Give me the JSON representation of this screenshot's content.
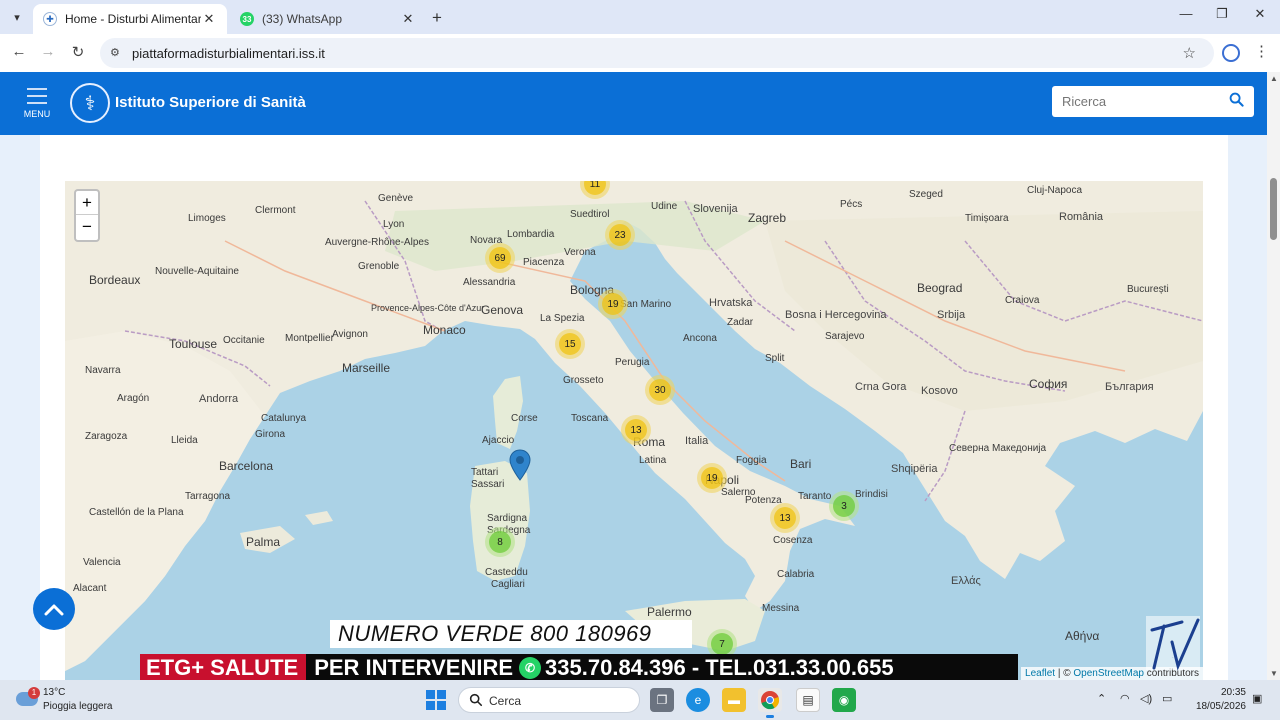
{
  "browser": {
    "tabs": [
      {
        "title": "Home - Disturbi Alimentari",
        "active": true,
        "favicon": "iss-favicon"
      },
      {
        "title": "(33) WhatsApp",
        "active": false,
        "favicon": "whatsapp-favicon",
        "badge": "33"
      }
    ],
    "url": "piattaformadisturbialimentari.iss.it"
  },
  "header": {
    "menu_label": "MENU",
    "site_title": "Istituto Superiore di Sanità",
    "search_placeholder": "Ricerca",
    "brand_color": "#0b6fd6"
  },
  "map": {
    "zoom_in": "+",
    "zoom_out": "−",
    "clusters": [
      {
        "count": "11",
        "color": "yellow"
      },
      {
        "count": "23",
        "color": "yellow"
      },
      {
        "count": "69",
        "color": "yellow"
      },
      {
        "count": "19",
        "color": "yellow"
      },
      {
        "count": "15",
        "color": "yellow"
      },
      {
        "count": "30",
        "color": "yellow"
      },
      {
        "count": "13",
        "color": "yellow"
      },
      {
        "count": "19",
        "color": "yellow"
      },
      {
        "count": "13",
        "color": "yellow"
      },
      {
        "count": "3",
        "color": "green"
      },
      {
        "count": "8",
        "color": "green"
      },
      {
        "count": "7",
        "color": "green"
      }
    ],
    "places": [
      "Cluj-Napoca",
      "Szeged",
      "Pécs",
      "România",
      "Timișoara",
      "Genève",
      "Clermont",
      "Limoges",
      "Lyon",
      "Suedtirol",
      "Udine",
      "Slovenija",
      "Zagreb",
      "Hrvatska",
      "Bordeaux",
      "Grenoble",
      "Nouvelle-Aquitaine",
      "Auvergne-Rhône-Alpes",
      "Novara",
      "Alessandria",
      "Lombardia",
      "Piacenza",
      "Verona",
      "Bologna",
      "Genova",
      "La Spezia",
      "San Marino",
      "Monaco",
      "Toulouse",
      "Occitanie",
      "Avignon",
      "Provence-Alpes-Côte d'Azur",
      "Montpellier",
      "Marseille",
      "Bosna i Hercegovina",
      "Srbija",
      "Beograd",
      "Craiova",
      "București",
      "Perugia",
      "Grosseto",
      "Ancona",
      "Zadar",
      "Split",
      "Sarajevo",
      "Crna Gora",
      "Kosovo",
      "София",
      "България",
      "Andorra",
      "Zaragoza",
      "Lleida",
      "Girona",
      "Barcelona",
      "Tarragona",
      "Corse",
      "Ajaccio",
      "Roma",
      "Italia",
      "Latina",
      "Napoli",
      "Foggia",
      "Bari",
      "Shqipëria",
      "Северна Македонија",
      "Potenza",
      "Taranto",
      "Brindisi",
      "Salerno",
      "Cosenza",
      "Calabria",
      "Tattari",
      "Sassari",
      "Sardigna",
      "Sardegna",
      "Casteddu",
      "Cagliari",
      "Palma",
      "Castellón de la Plana",
      "Valencia",
      "Alacant",
      "Palermo",
      "Messina",
      "Ελλάς",
      "Αθήνα",
      "Aragón",
      "Navarra",
      "Catalunya",
      "Toscana"
    ],
    "attribution_leaflet": "Leaflet",
    "attribution_sep": " | © ",
    "attribution_osm": "OpenStreetMap",
    "attribution_tail": " contributors"
  },
  "overlay": {
    "numero_verde": "NUMERO VERDE 800 180969",
    "brand": "ETG+ SALUTE",
    "cta": "PER INTERVENIRE",
    "phones": "335.70.84.396 - TEL.031.33.00.655",
    "logo_text": "TV"
  },
  "taskbar": {
    "weather_temp": "13°C",
    "weather_desc": "Pioggia leggera",
    "weather_badge": "1",
    "search_label": "Cerca",
    "time": "20:35",
    "date": "18/05/2026"
  }
}
